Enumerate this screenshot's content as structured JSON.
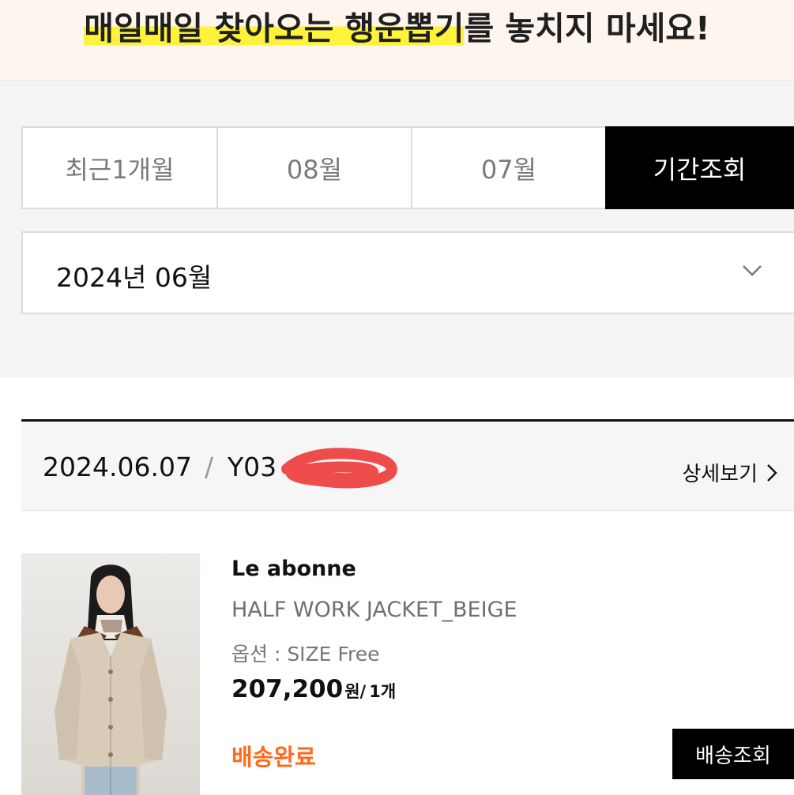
{
  "banner": {
    "highlight_text": "매일매일 찾아오는 행운뽑기",
    "rest_text": "를 놓치지 마세요!"
  },
  "period_tabs": [
    {
      "label": "최근1개월",
      "active": false
    },
    {
      "label": "08월",
      "active": false
    },
    {
      "label": "07월",
      "active": false
    },
    {
      "label": "기간조회",
      "active": true
    }
  ],
  "month_select": {
    "value": "2024년 06월",
    "icon": "chevron-down-icon"
  },
  "order": {
    "date": "2024.06.07",
    "separator": "/",
    "order_no_visible": "Y03",
    "detail_label": "상세보기",
    "item": {
      "brand": "Le abonne",
      "name": "HALF WORK JACKET_BEIGE",
      "option": "옵션 : SIZE Free",
      "price": "207,200",
      "price_unit": "원/",
      "quantity": "1개",
      "status": "배송완료",
      "tracking_label": "배송조회"
    }
  },
  "colors": {
    "banner_bg": "#fdf5ee",
    "highlight": "#fff23a",
    "active_tab": "#000000",
    "status_orange": "#ff6a1a",
    "redaction": "#ee4b4b"
  }
}
